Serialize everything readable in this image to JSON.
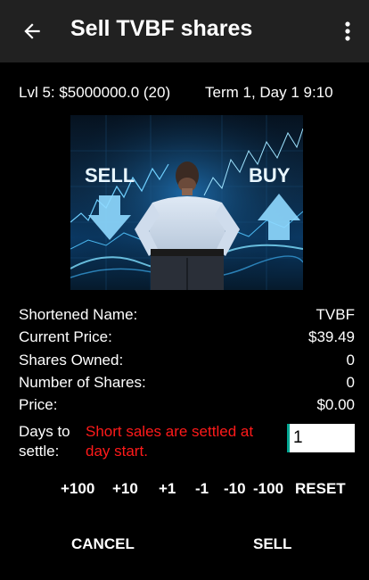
{
  "header": {
    "title": "Sell TVBF shares",
    "back_icon": "arrow-left-icon",
    "menu_icon": "more-vertical-icon"
  },
  "status": {
    "level_info": "Lvl 5: $5000000.0 (20)",
    "term_info": "Term 1, Day 1  9:10"
  },
  "hero": {
    "sell_text": "SELL",
    "buy_text": "BUY"
  },
  "details": [
    {
      "label": "Shortened Name:",
      "value": "TVBF"
    },
    {
      "label": "Current Price:",
      "value": "$39.49"
    },
    {
      "label": "Shares Owned:",
      "value": "0"
    },
    {
      "label": "Number of Shares:",
      "value": "0"
    },
    {
      "label": "Price:",
      "value": "$0.00"
    }
  ],
  "settle": {
    "label": "Days to settle:",
    "warning": "Short sales are settled at day start.",
    "input_value": "1"
  },
  "adjust_buttons": [
    "+100",
    "+10",
    "+1",
    "-1",
    "-10",
    "-100",
    "RESET"
  ],
  "actions": {
    "cancel": "CANCEL",
    "sell": "SELL"
  },
  "colors": {
    "appbar": "#212121",
    "background": "#000000",
    "warning": "#ff1a1a",
    "input_accent": "#00a693"
  }
}
